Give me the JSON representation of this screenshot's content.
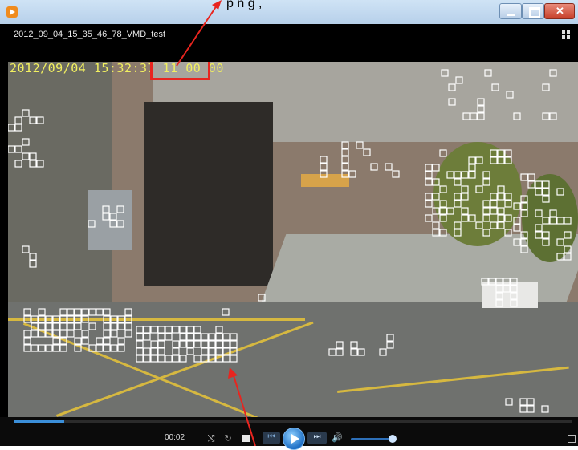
{
  "annotation": {
    "caption": "p       n g            ,"
  },
  "player": {
    "file_title": "2012_09_04_15_35_46_78_VMD_test",
    "timestamp_date": "2012/09/04",
    "timestamp_time": "15:32:37",
    "timestamp_frame": "11 00 00",
    "elapsed_time": "00:02",
    "progress_fraction": 0.09,
    "volume_fraction": 0.85
  },
  "icons": {
    "app": "media-player-icon",
    "minimize": "minimize-icon",
    "maximize": "maximize-icon",
    "close": "close-icon",
    "layout": "layout-icon",
    "shuffle": "shuffle-icon",
    "repeat": "repeat-icon",
    "stop": "stop-icon",
    "previous": "previous-icon",
    "play": "play-icon",
    "next": "next-icon",
    "volume": "volume-icon",
    "fullscreen": "fullscreen-icon"
  },
  "colors": {
    "annotation_red": "#e8251f",
    "timestamp_yellow": "#f2f060",
    "accent_blue": "#3b8fd9"
  }
}
